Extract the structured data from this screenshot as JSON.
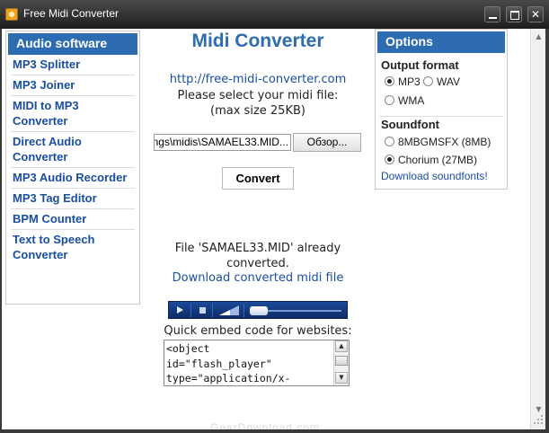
{
  "window": {
    "title": "Free Midi Converter"
  },
  "sidebar": {
    "header": "Audio software",
    "items": [
      {
        "label": "MP3 Splitter"
      },
      {
        "label": "MP3 Joiner"
      },
      {
        "label": "MIDI to MP3 Converter"
      },
      {
        "label": "Direct Audio Converter"
      },
      {
        "label": "MP3 Audio Recorder"
      },
      {
        "label": "MP3 Tag Editor"
      },
      {
        "label": "BPM Counter"
      },
      {
        "label": "Text to Speech Converter"
      }
    ]
  },
  "main": {
    "title": "Midi Converter",
    "site_link": "http://free-midi-converter.com",
    "prompt_line1": "Please select your midi file:",
    "prompt_line2": "(max size 25KB)",
    "file_value": "...ngs\\midis\\SAMAEL33.MID",
    "browse_label": "Обзор...",
    "convert_label": "Convert",
    "status_line1": "File 'SAMAEL33.MID' already",
    "status_line2": "converted.",
    "download_link": "Download converted midi file",
    "player": {
      "seek_position": 0
    },
    "embed_label": "Quick embed code for websites:",
    "embed_code": "<object\nid=\"flash_player\"\ntype=\"application/x-"
  },
  "options": {
    "header": "Options",
    "output_format": {
      "title": "Output format",
      "choices": [
        {
          "label": "MP3",
          "selected": true
        },
        {
          "label": "WAV",
          "selected": false
        },
        {
          "label": "WMA",
          "selected": false
        }
      ]
    },
    "soundfont": {
      "title": "Soundfont",
      "choices": [
        {
          "label": "8MBGMSFX (8MB)",
          "selected": false
        },
        {
          "label": "Chorium (27MB)",
          "selected": true
        }
      ],
      "download_link": "Download soundfonts!"
    }
  },
  "watermark": "GearDownload.com",
  "colors": {
    "accent": "#2e6cb1",
    "link": "#1a4fa0",
    "player": "#1b4a9b"
  }
}
